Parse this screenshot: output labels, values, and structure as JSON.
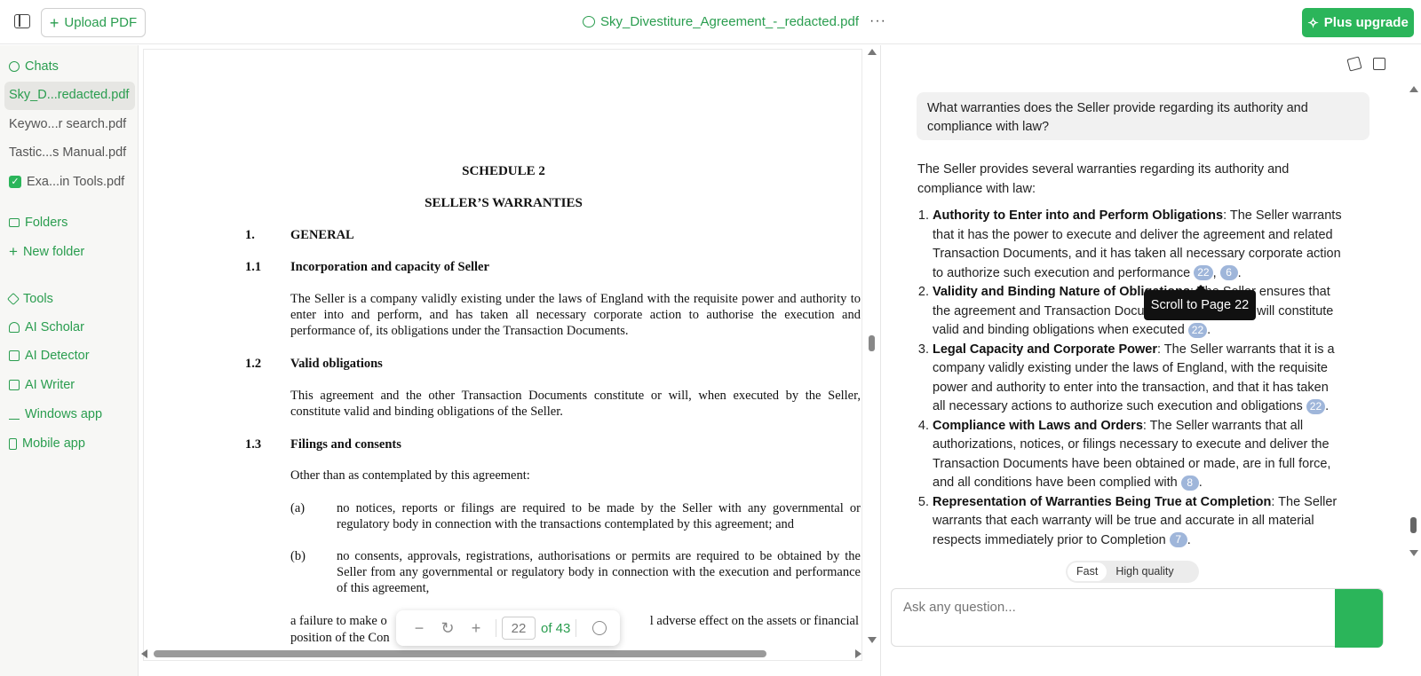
{
  "header": {
    "upload_label": "Upload PDF",
    "doc_title": "Sky_Divestiture_Agreement_-_redacted.pdf",
    "more": "···",
    "upgrade_label": "Plus upgrade"
  },
  "sidebar": {
    "chats": "Chats",
    "files": [
      {
        "label": "Sky_D...redacted.pdf",
        "active": true
      },
      {
        "label": "Keywo...r search.pdf"
      },
      {
        "label": "Tastic...s Manual.pdf"
      },
      {
        "label": "Exa...in Tools.pdf",
        "checked": true
      }
    ],
    "folders": "Folders",
    "new_folder": "New folder",
    "tools": [
      {
        "label": "Tools",
        "icon": "wrench-icon"
      },
      {
        "label": "AI Scholar",
        "icon": "graduation-cap-icon"
      },
      {
        "label": "AI Detector",
        "icon": "detector-icon"
      },
      {
        "label": "AI Writer",
        "icon": "pen-icon"
      },
      {
        "label": "Windows app",
        "icon": "download-icon"
      },
      {
        "label": "Mobile app",
        "icon": "phone-icon"
      }
    ]
  },
  "pdf": {
    "schedule": "SCHEDULE 2",
    "subtitle": "SELLER’S WARRANTIES",
    "s1_num": "1.",
    "s1_title": "GENERAL",
    "s11_num": "1.1",
    "s11_title": "Incorporation and capacity of Seller",
    "s11_body": "The Seller is a company validly existing under the laws of England with the requisite power and authority to enter into and perform, and has taken all necessary corporate action to authorise the execution and performance of, its obligations under the Transaction Documents.",
    "s12_num": "1.2",
    "s12_title": "Valid obligations",
    "s12_body": "This agreement and the other Transaction Documents constitute or will, when executed by the Seller, constitute valid and binding obligations of the Seller.",
    "s13_num": "1.3",
    "s13_title": "Filings and consents",
    "s13_intro": "Other than as contemplated by this agreement:",
    "a_label": "(a)",
    "a_body": "no notices, reports or filings are required to be made by the Seller with any governmental or regulatory body in connection with the transactions contemplated by this agreement; and",
    "b_label": "(b)",
    "b_body": "no consents, approvals, registrations, authorisations or permits are required to be obtained by the Seller from any governmental or regulatory body in connection with the execution and performance of this agreement,",
    "tail_left_1": "a failure to make o",
    "tail_right_1": "l adverse effect on the assets or financial",
    "tail_left_2": "position of the Con"
  },
  "zoom": {
    "minus": "−",
    "reset": "↻",
    "plus": "+",
    "page": "22",
    "of_total": "of 43"
  },
  "chat": {
    "question": "What warranties does the Seller provide regarding its authority and compliance with law?",
    "intro": "The Seller provides several warranties regarding its authority and compliance with law:",
    "items": [
      {
        "title": "Authority to Enter into and Perform Obligations",
        "text": ": The Seller warrants that it has the power to execute and deliver the agreement and related Transaction Documents, and it has taken all necessary corporate action to authorize such execution and performance ",
        "cites": [
          "22",
          "6"
        ]
      },
      {
        "title": "Validity and Binding Nature of Obligations",
        "text": ": The Seller ensures that the agreement and Transaction Documents constitute or will constitute valid and binding obligations when executed ",
        "cites": [
          "22"
        ]
      },
      {
        "title": "Legal Capacity and Corporate Power",
        "text": ": The Seller warrants that it is a company validly existing under the laws of England, with the requisite power and authority to enter into the transaction, and that it has taken all necessary actions to authorize such execution and obligations ",
        "cites": [
          "22"
        ]
      },
      {
        "title": "Compliance with Laws and Orders",
        "text": ": The Seller warrants that all authorizations, notices, or filings necessary to execute and deliver the Transaction Documents have been obtained or made, are in full force, and all conditions have been complied with ",
        "cites": [
          "8"
        ]
      },
      {
        "title": "Representation of Warranties Being True at Completion",
        "text": ": The Seller warrants that each warranty will be true and accurate in all material respects immediately prior to Completion ",
        "cites": [
          "7"
        ]
      }
    ],
    "tooltip": "Scroll to Page 22",
    "fast": "Fast",
    "high_quality": "High quality",
    "ask_placeholder": "Ask any question..."
  }
}
